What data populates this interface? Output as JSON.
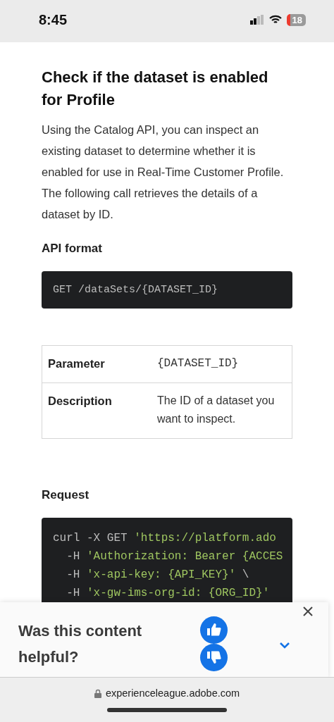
{
  "status_bar": {
    "time": "8:45",
    "battery": "18"
  },
  "heading": "Check if the dataset is enabled for Profile",
  "intro": "Using the Catalog API, you can inspect an existing dataset to determine whether it is enabled for use in Real-Time Customer Profile. The following call retrieves the details of a dataset by ID.",
  "api_format": {
    "heading": "API format",
    "code": "GET /dataSets/{DATASET_ID}"
  },
  "table": {
    "rows": [
      {
        "label": "Parameter",
        "value": "{DATASET_ID}",
        "kind": "code"
      },
      {
        "label": "Description",
        "value": "The ID of a dataset you want to inspect.",
        "kind": "text"
      }
    ]
  },
  "request": {
    "heading": "Request",
    "lines": [
      [
        {
          "kind": "plain",
          "text": "curl -X GET "
        },
        {
          "kind": "string",
          "text": "'https://platform.ado"
        }
      ],
      [
        {
          "kind": "plain",
          "text": "  -H "
        },
        {
          "kind": "string",
          "text": "'Authorization: Bearer {ACCES"
        }
      ],
      [
        {
          "kind": "plain",
          "text": "  -H "
        },
        {
          "kind": "string",
          "text": "'x-api-key: {API_KEY}'"
        },
        {
          "kind": "plain",
          "text": " \\"
        }
      ],
      [
        {
          "kind": "plain",
          "text": "  -H "
        },
        {
          "kind": "string",
          "text": "'x-gw-ims-org-id: {ORG_ID}'"
        }
      ]
    ]
  },
  "feedback": {
    "question": "Was this content helpful?"
  },
  "browser_bar": {
    "url": "experienceleague.adobe.com"
  }
}
